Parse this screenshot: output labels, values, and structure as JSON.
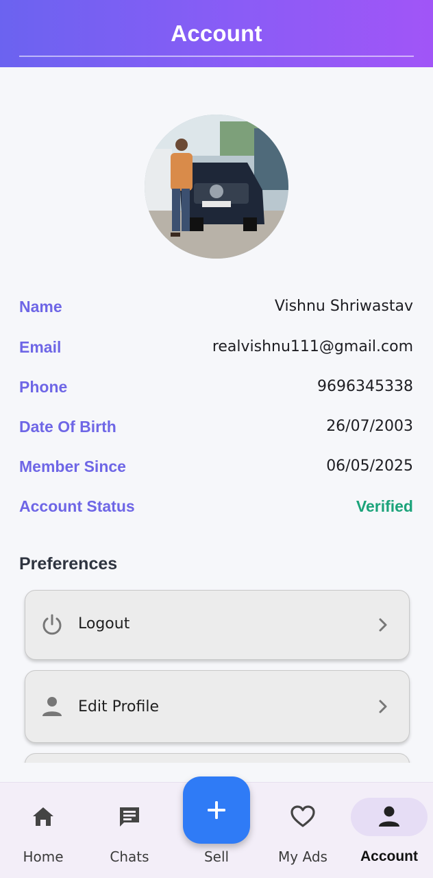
{
  "header": {
    "title": "Account"
  },
  "profile": {
    "fields": [
      {
        "label": "Name",
        "value": "Vishnu Shriwastav"
      },
      {
        "label": "Email",
        "value": "realvishnu111@gmail.com"
      },
      {
        "label": "Phone",
        "value": "9696345338"
      },
      {
        "label": "Date Of Birth",
        "value": "26/07/2003"
      },
      {
        "label": "Member Since",
        "value": "06/05/2025"
      },
      {
        "label": "Account Status",
        "value": "Verified"
      }
    ],
    "status_color": "#1ba37a",
    "label_color": "#6e66e6"
  },
  "preferences": {
    "title": "Preferences",
    "items": [
      {
        "label": "Logout",
        "icon": "power-icon"
      },
      {
        "label": "Edit Profile",
        "icon": "person-icon"
      }
    ]
  },
  "bottom_nav": {
    "items": [
      {
        "label": "Home",
        "icon": "home-icon"
      },
      {
        "label": "Chats",
        "icon": "chat-icon"
      },
      {
        "label": "Sell",
        "icon": "plus-icon"
      },
      {
        "label": "My Ads",
        "icon": "heart-icon"
      },
      {
        "label": "Account",
        "icon": "person-icon",
        "active": true
      }
    ],
    "fab_color": "#2f7bf6"
  },
  "colors": {
    "header_gradient_start": "#6b63f0",
    "header_gradient_end": "#a155f7"
  }
}
